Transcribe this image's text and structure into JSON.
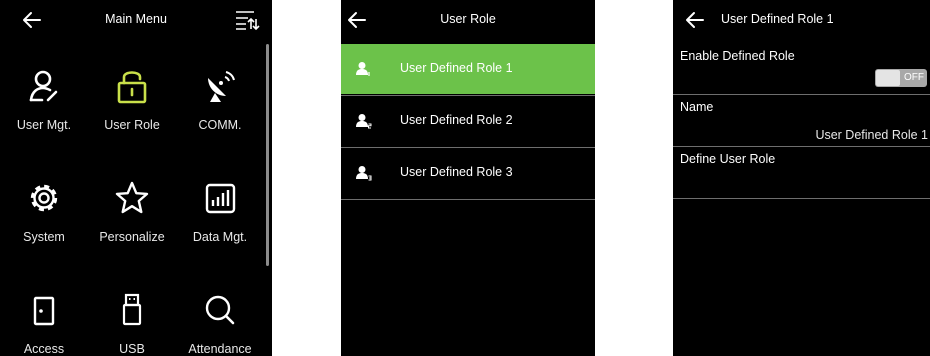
{
  "main_menu": {
    "title": "Main Menu",
    "items": [
      {
        "label": "User Mgt.",
        "icon": "user-icon"
      },
      {
        "label": "User Role",
        "icon": "padlock-icon"
      },
      {
        "label": "COMM.",
        "icon": "satellite-dish-icon"
      },
      {
        "label": "System",
        "icon": "gear-icon"
      },
      {
        "label": "Personalize",
        "icon": "star-icon"
      },
      {
        "label": "Data Mgt.",
        "icon": "bar-chart-icon"
      },
      {
        "label": "Access",
        "icon": "door-icon"
      },
      {
        "label": "USB",
        "icon": "usb-drive-icon"
      },
      {
        "label": "Attendance",
        "icon": "search-icon"
      }
    ]
  },
  "user_role": {
    "title": "User Role",
    "roles": [
      {
        "label": "User Defined Role 1",
        "selected": true
      },
      {
        "label": "User Defined Role 2",
        "selected": false
      },
      {
        "label": "User Defined Role 3",
        "selected": false
      }
    ]
  },
  "role_detail": {
    "title": "User Defined Role 1",
    "enable_label": "Enable Defined Role",
    "enable_state": "OFF",
    "name_label": "Name",
    "name_value": "User Defined Role 1",
    "define_label": "Define User Role"
  },
  "colors": {
    "accent_selected": "#6cc24a",
    "icon_highlight": "#c9e04a",
    "screen_bg": "#000000"
  }
}
